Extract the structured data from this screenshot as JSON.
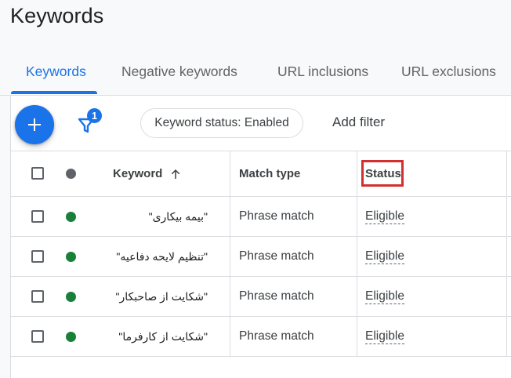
{
  "page": {
    "title": "Keywords"
  },
  "tabs": [
    {
      "label": "Keywords",
      "active": true
    },
    {
      "label": "Negative keywords",
      "active": false
    },
    {
      "label": "URL inclusions",
      "active": false
    },
    {
      "label": "URL exclusions",
      "active": false
    }
  ],
  "toolbar": {
    "add_icon": "plus-icon",
    "filter_icon": "filter-icon",
    "filter_count": "1",
    "status_chip": "Keyword status: Enabled",
    "add_filter": "Add filter"
  },
  "table": {
    "headers": {
      "keyword": "Keyword",
      "match_type": "Match type",
      "status": "Status"
    },
    "sort_icon": "arrow-up-icon",
    "rows": [
      {
        "keyword": "\"بیمه بیکاری\"",
        "match_type": "Phrase match",
        "status": "Eligible"
      },
      {
        "keyword": "\"تنظیم لایحه دفاعیه\"",
        "match_type": "Phrase match",
        "status": "Eligible"
      },
      {
        "keyword": "\"شکایت از صاحبکار\"",
        "match_type": "Phrase match",
        "status": "Eligible"
      },
      {
        "keyword": "\"شکایت از کارفرما\"",
        "match_type": "Phrase match",
        "status": "Eligible"
      }
    ]
  },
  "colors": {
    "accent": "#1a73e8",
    "status_enabled": "#188038",
    "highlight": "#d32f2f"
  }
}
